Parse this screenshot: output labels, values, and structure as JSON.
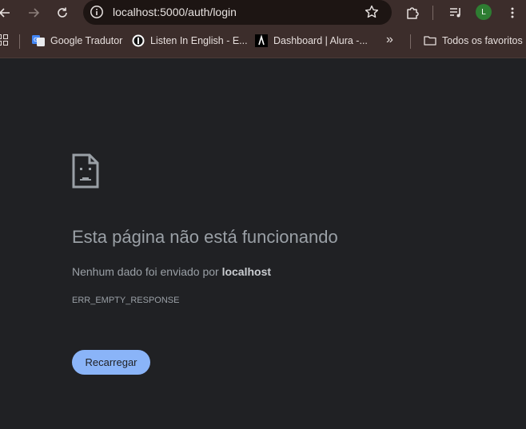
{
  "browser": {
    "url": "localhost:5000/auth/login",
    "profile_initial": "L",
    "accent_color": "#3c2d2b"
  },
  "bookmarks": {
    "items": [
      {
        "label": "Google Tradutor",
        "icon": "google-translate-icon"
      },
      {
        "label": "Listen In English - E...",
        "icon": "listen-in-english-icon"
      },
      {
        "label": "Dashboard | Alura -...",
        "icon": "alura-icon"
      }
    ],
    "overflow_label": "»",
    "all_bookmarks_label": "Todos os favoritos"
  },
  "error_page": {
    "title": "Esta página não está funcionando",
    "description_prefix": "Nenhum dado foi enviado por ",
    "description_host": "localhost",
    "error_code": "ERR_EMPTY_RESPONSE",
    "reload_label": "Recarregar",
    "button_color": "#8ab4f8"
  }
}
